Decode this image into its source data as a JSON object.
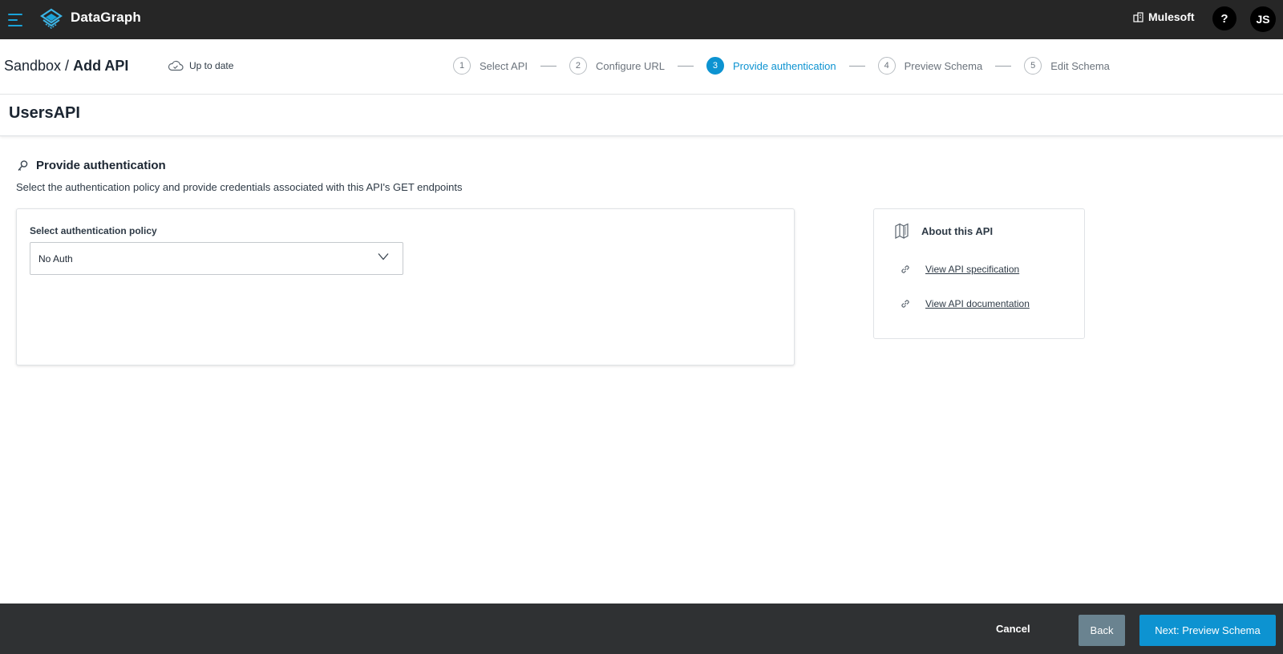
{
  "topbar": {
    "brand": "DataGraph",
    "org": "Mulesoft",
    "help": "?",
    "avatar_initials": "JS"
  },
  "header": {
    "breadcrumb_parent": "Sandbox /",
    "breadcrumb_current": "Add API",
    "status": "Up to date"
  },
  "stepper": {
    "steps": [
      {
        "num": "1",
        "label": "Select API"
      },
      {
        "num": "2",
        "label": "Configure URL"
      },
      {
        "num": "3",
        "label": "Provide authentication"
      },
      {
        "num": "4",
        "label": "Preview Schema"
      },
      {
        "num": "5",
        "label": "Edit Schema"
      }
    ],
    "active_step": 3
  },
  "page": {
    "title": "UsersAPI"
  },
  "auth": {
    "section_title": "Provide authentication",
    "description": "Select the authentication policy and provide credentials associated with this API's GET endpoints",
    "policy_label": "Select authentication policy",
    "policy_value": "No Auth"
  },
  "about": {
    "title": "About this API",
    "spec_link": "View API specification",
    "docs_link": "View API documentation"
  },
  "footer": {
    "cancel": "Cancel",
    "back": "Back",
    "next": "Next: Preview Schema"
  },
  "colors": {
    "topbar": "#262626",
    "accent": "#0d93d1",
    "back_button": "#6a8390",
    "footer": "#2f3133"
  }
}
